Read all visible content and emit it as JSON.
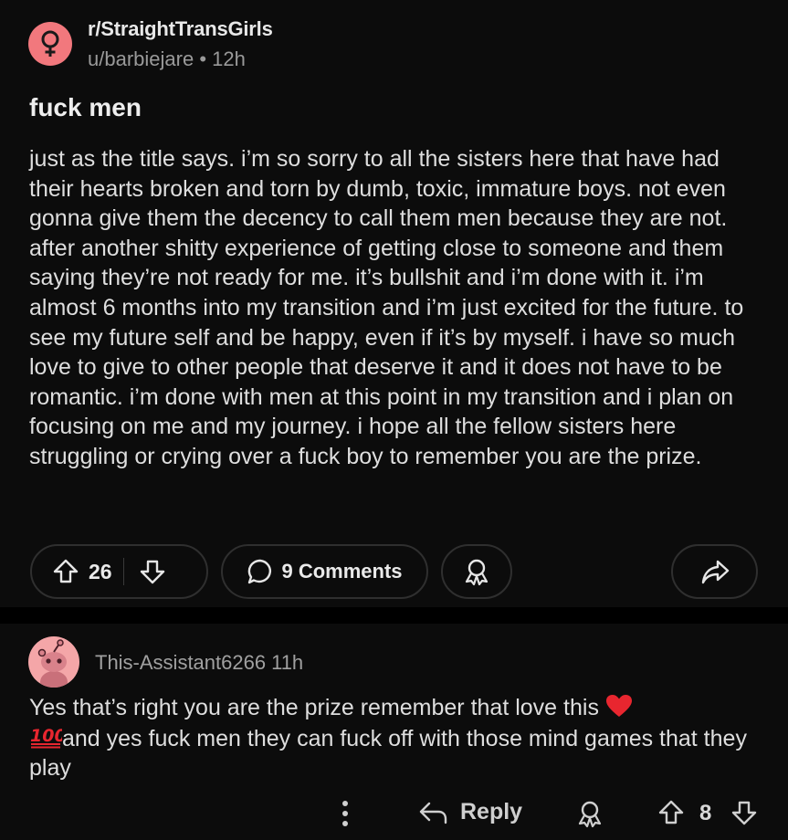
{
  "post": {
    "subreddit": "r/StraightTransGirls",
    "author": "u/barbiejare",
    "time_ago": "12h",
    "meta_separator": "•",
    "title": "fuck men",
    "body": "just as the title says. i’m so sorry to all the sisters here that have had their hearts broken and torn by dumb, toxic, immature boys. not even gonna give them the decency to call them men because they are not. after another shitty experience of getting close to someone and them saying they’re not ready for me. it’s bullshit and i’m done with it. i’m almost 6 months into my transition and i’m just excited for the future. to see my future self and be happy, even if it’s by myself. i have so much love to give to other people that deserve it and it does not have to be romantic. i’m done with men at this point in my transition and i plan on focusing on me and my journey. i hope all the fellow sisters here struggling or crying over a fuck boy to remember you are the prize.",
    "vote_count": "26",
    "comments_label": "9 Comments",
    "subreddit_icon": "female-symbol-icon",
    "avatar_color": "#f2787d"
  },
  "comment": {
    "username": "This-Assistant6266",
    "time_ago": "11h",
    "body_part1": "Yes that’s right you are the prize remember that love this ",
    "body_part2": "and yes fuck men they can fuck off with those mind games that they play",
    "emoji_heart": "red-heart-icon",
    "emoji_100": "hundred-points-icon",
    "reply_label": "Reply",
    "vote_count": "8",
    "avatar_color": "#f4a6a8"
  },
  "colors": {
    "background": "#0c0c0c",
    "separator": "#000000",
    "text_primary": "#dedede",
    "text_secondary": "#9a9a9a",
    "pill_border": "#2f2f2f"
  }
}
